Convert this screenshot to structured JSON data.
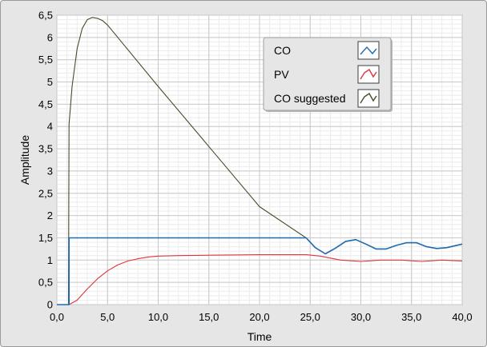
{
  "chart_data": {
    "type": "line",
    "xlabel": "Time",
    "ylabel": "Amplitude",
    "xlim": [
      0,
      40
    ],
    "ylim": [
      0,
      6.5
    ],
    "x_ticks": [
      "0,0",
      "5,0",
      "10,0",
      "15,0",
      "20,0",
      "25,0",
      "30,0",
      "35,0",
      "40,0"
    ],
    "y_ticks": [
      "0",
      "0,5",
      "1",
      "1,5",
      "2",
      "2,5",
      "3",
      "3,5",
      "4",
      "4,5",
      "5",
      "5,5",
      "6",
      "6,5"
    ],
    "grid": true,
    "legend_position": "top-right",
    "series": [
      {
        "name": "CO",
        "color": "#1f6bb0",
        "x": [
          0,
          1.2,
          1.2,
          24.6,
          25.5,
          26.5,
          27.5,
          28.5,
          29.5,
          30.5,
          31.5,
          32.5,
          33.5,
          34.5,
          35.5,
          36.5,
          37.5,
          38.5,
          40
        ],
        "y": [
          0,
          0,
          1.5,
          1.5,
          1.28,
          1.14,
          1.27,
          1.42,
          1.46,
          1.36,
          1.25,
          1.25,
          1.33,
          1.39,
          1.39,
          1.3,
          1.26,
          1.28,
          1.36
        ]
      },
      {
        "name": "PV",
        "color": "#e0343a",
        "x": [
          0,
          1.2,
          2,
          3,
          4,
          5,
          6,
          7,
          8,
          9,
          10,
          12,
          15,
          20,
          24.6,
          26,
          28,
          30,
          32,
          34,
          36,
          38,
          40
        ],
        "y": [
          0,
          0,
          0.1,
          0.35,
          0.58,
          0.76,
          0.89,
          0.98,
          1.03,
          1.07,
          1.09,
          1.1,
          1.11,
          1.12,
          1.12,
          1.09,
          1.0,
          0.97,
          1.0,
          1.0,
          0.97,
          1.0,
          0.98
        ]
      },
      {
        "name": "CO suggested",
        "color": "#4a4a2c",
        "x": [
          0,
          1.15,
          1.2,
          1.5,
          2,
          2.5,
          3,
          3.5,
          4,
          4.5,
          5,
          10,
          15,
          20,
          24.6,
          25.5,
          26.5,
          27.5,
          28.5,
          29.5,
          30.5,
          31.5,
          32.5,
          33.5,
          34.5,
          35.5,
          36.5,
          37.5,
          38.5,
          40
        ],
        "y": [
          0,
          0,
          4.05,
          4.9,
          5.75,
          6.2,
          6.4,
          6.45,
          6.43,
          6.38,
          6.28,
          4.9,
          3.55,
          2.2,
          1.5,
          1.28,
          1.14,
          1.27,
          1.42,
          1.46,
          1.36,
          1.25,
          1.25,
          1.33,
          1.39,
          1.39,
          1.3,
          1.26,
          1.28,
          1.36
        ]
      }
    ]
  }
}
